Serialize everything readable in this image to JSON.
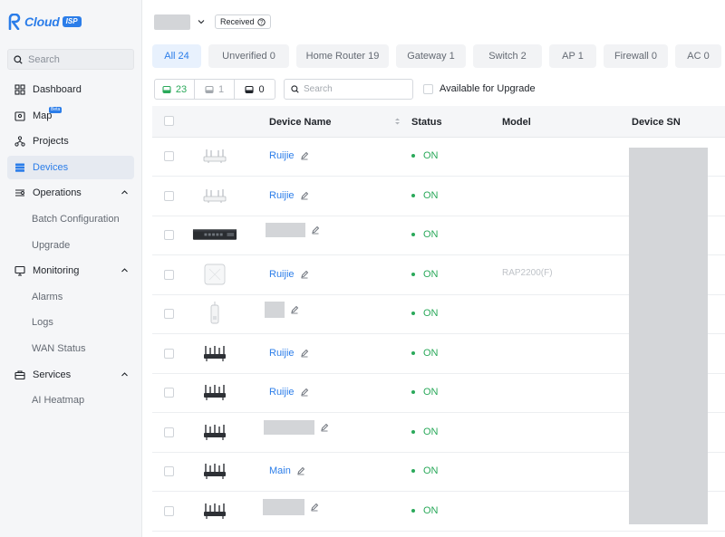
{
  "brand": {
    "name": "Cloud",
    "badge": "ISP",
    "color": "#2b7de9"
  },
  "sidebar": {
    "search_placeholder": "Search",
    "items": [
      {
        "label": "Dashboard",
        "icon": "dashboard-icon"
      },
      {
        "label": "Map",
        "icon": "map-icon",
        "badge": "Beta"
      },
      {
        "label": "Projects",
        "icon": "projects-icon"
      },
      {
        "label": "Devices",
        "icon": "devices-icon",
        "active": true
      },
      {
        "label": "Operations",
        "icon": "operations-icon",
        "expanded": true,
        "children": [
          "Batch Configuration",
          "Upgrade"
        ]
      },
      {
        "label": "Monitoring",
        "icon": "monitoring-icon",
        "expanded": true,
        "children": [
          "Alarms",
          "Logs",
          "WAN Status"
        ]
      },
      {
        "label": "Services",
        "icon": "services-icon",
        "expanded": true,
        "children": [
          "AI Heatmap"
        ]
      }
    ]
  },
  "top": {
    "received_label": "Received"
  },
  "tabs": [
    "All 24",
    "Unverified 0",
    "Home Router 19",
    "Gateway 1",
    "Switch 2",
    "AP 1",
    "Firewall 0",
    "AC 0"
  ],
  "filters": {
    "online": "23",
    "offline": "1",
    "other": "0",
    "search_placeholder": "Search",
    "upgrade_label": "Available for Upgrade"
  },
  "table": {
    "columns": [
      "Device Name",
      "Status",
      "Model",
      "Device SN"
    ],
    "rows": [
      {
        "name": "Ruijie",
        "status": "ON",
        "model": "",
        "type": "router"
      },
      {
        "name": "Ruijie",
        "status": "ON",
        "model": "",
        "type": "router"
      },
      {
        "name": "",
        "status": "ON",
        "model": "",
        "type": "switch"
      },
      {
        "name": "Ruijie",
        "status": "ON",
        "model": "RAP2200(F)",
        "type": "ap"
      },
      {
        "name": "",
        "status": "ON",
        "model": "",
        "type": "outdoor"
      },
      {
        "name": "Ruijie",
        "status": "ON",
        "model": "",
        "type": "mesh"
      },
      {
        "name": "Ruijie",
        "status": "ON",
        "model": "",
        "type": "mesh"
      },
      {
        "name": "",
        "status": "ON",
        "model": "",
        "type": "mesh"
      },
      {
        "name": "Main",
        "status": "ON",
        "model": "",
        "type": "mesh"
      },
      {
        "name": "",
        "status": "ON",
        "model": "",
        "type": "mesh"
      }
    ]
  }
}
